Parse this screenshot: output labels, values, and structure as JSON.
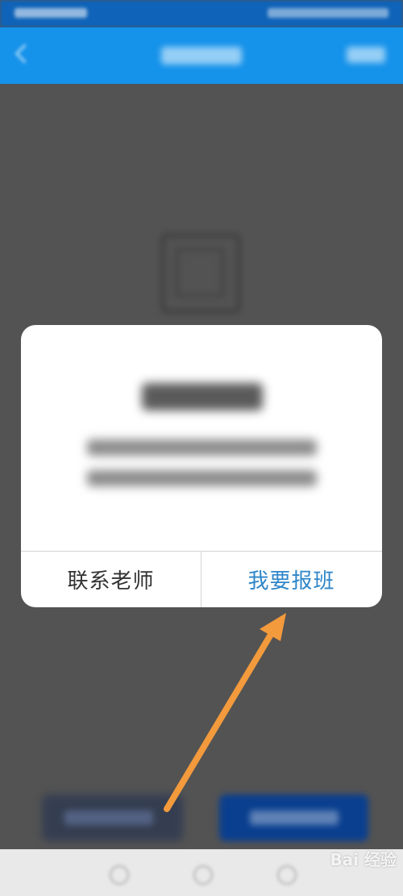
{
  "dialog": {
    "contact_label": "联系老师",
    "enroll_label": "我要报班"
  },
  "watermark": {
    "text": "Bai 经验"
  },
  "colors": {
    "title_bar": "#1592ea",
    "status_bar": "#0f63b8",
    "overlay": "#535353",
    "enroll_text": "#2e86c9",
    "arrow": "#f39a3c",
    "primary_button": "#0a3f8f"
  },
  "icons": [
    "back-icon",
    "arrow-annotation-icon"
  ]
}
